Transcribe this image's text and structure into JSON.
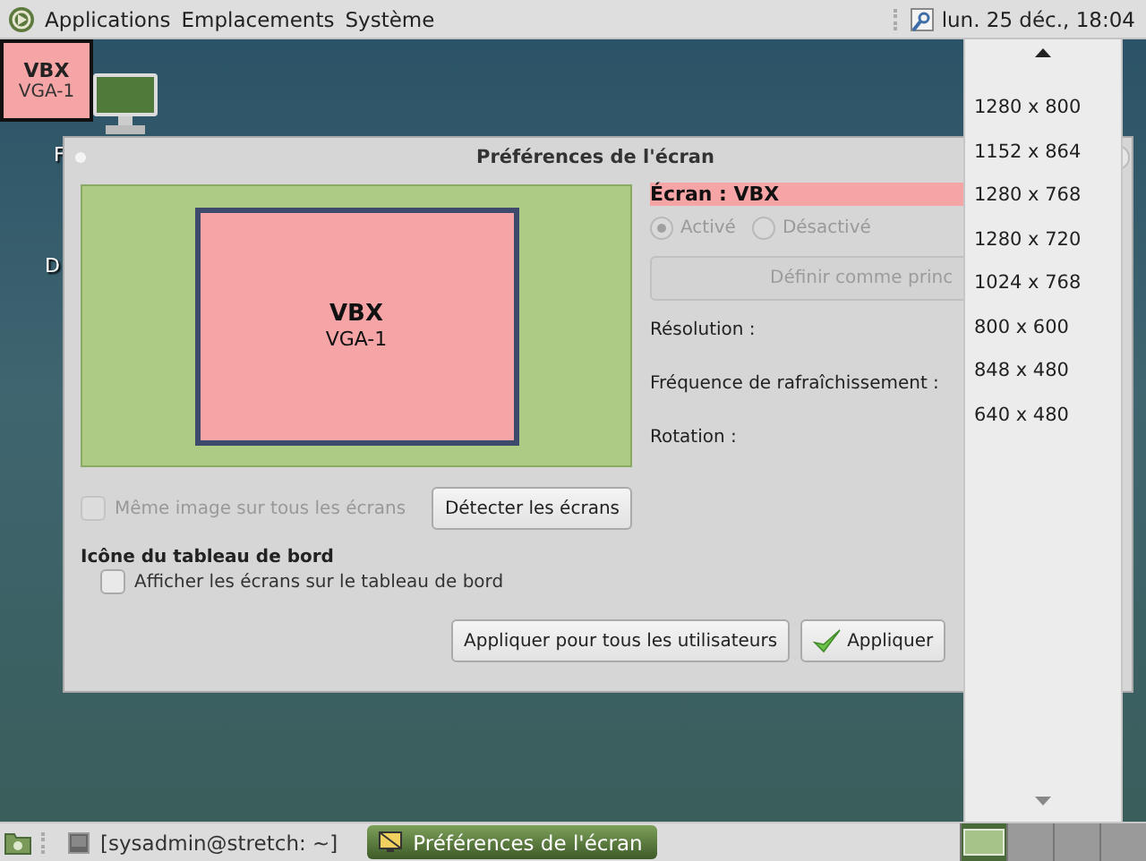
{
  "top_panel": {
    "menus": [
      {
        "label": "Applications"
      },
      {
        "label": "Emplacements"
      },
      {
        "label": "Système"
      }
    ],
    "clock": "lun. 25 déc., 18:04"
  },
  "desktop": {
    "screen_label": {
      "name": "VBX",
      "output": "VGA-1"
    },
    "icon_labels": [
      "F",
      "D"
    ]
  },
  "dialog": {
    "title": "Préférences de l'écran",
    "preview": {
      "name": "VBX",
      "output": "VGA-1"
    },
    "screen_heading": "Écran : VBX",
    "radios": [
      {
        "label": "Activé",
        "selected": true,
        "disabled": true
      },
      {
        "label": "Désactivé",
        "selected": false,
        "disabled": true
      }
    ],
    "primary_button": {
      "label": "Définir comme princ",
      "disabled": true
    },
    "settings": [
      "Résolution :",
      "Fréquence de rafraîchissement :",
      "Rotation :"
    ],
    "mirror": {
      "label": "Même image sur tous les écrans",
      "checked": false,
      "disabled": true
    },
    "detect_button": "Détecter les écrans",
    "panel_section": {
      "title": "Icône du tableau de bord",
      "checkbox": {
        "label": "Afficher les écrans sur le tableau de bord",
        "checked": false,
        "disabled": false
      }
    },
    "buttons": [
      {
        "label": "Appliquer pour tous les utilisateurs",
        "kind": "plain"
      },
      {
        "label": "Appliquer",
        "kind": "apply"
      }
    ]
  },
  "resolution_menu": {
    "items": [
      "1280 x 800",
      "1152 x 864",
      "1280 x 768",
      "1280 x 720",
      "1024 x 768",
      "800 x 600",
      "848 x 480",
      "640 x 480"
    ]
  },
  "bottom_panel": {
    "tasks": [
      {
        "label": "[sysadmin@stretch: ~]",
        "selected": false,
        "kind": "terminal"
      },
      {
        "label": "Préférences de l'écran",
        "selected": true,
        "kind": "display"
      }
    ],
    "workspaces": [
      {
        "selected": true
      },
      {
        "selected": false
      },
      {
        "selected": false
      },
      {
        "selected": false
      }
    ]
  }
}
